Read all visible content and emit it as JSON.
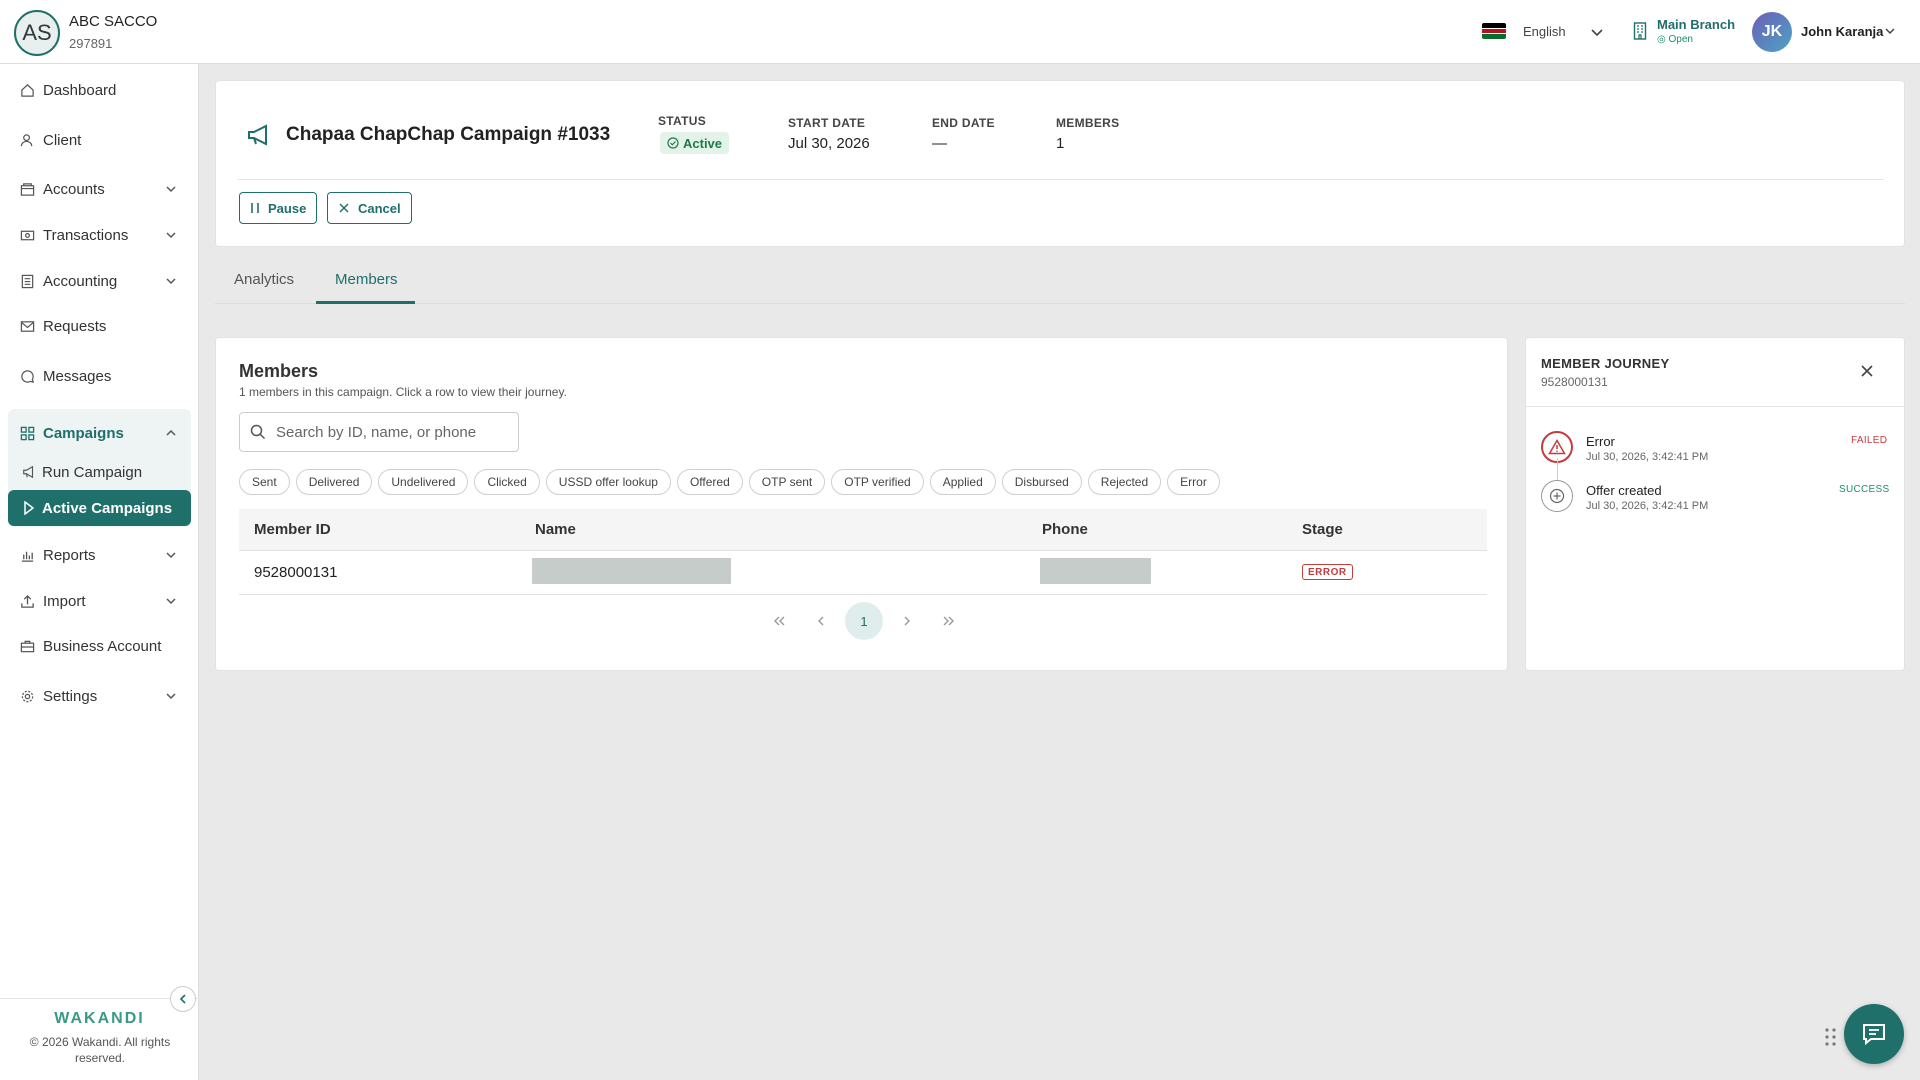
{
  "org": {
    "initials": "AS",
    "name": "ABC SACCO",
    "id": "297891"
  },
  "topbar": {
    "language": "English",
    "branch_name": "Main Branch",
    "branch_status": "Open",
    "user_initials": "JK",
    "user_name": "John Karanja"
  },
  "sidebar": {
    "items": [
      {
        "label": "Dashboard",
        "icon": "home-icon"
      },
      {
        "label": "Client",
        "icon": "user-icon"
      },
      {
        "label": "Accounts",
        "icon": "wallet-icon"
      },
      {
        "label": "Transactions",
        "icon": "money-icon"
      },
      {
        "label": "Accounting",
        "icon": "ledger-icon"
      },
      {
        "label": "Requests",
        "icon": "mail-icon"
      },
      {
        "label": "Messages",
        "icon": "chat-icon"
      },
      {
        "label": "Campaigns",
        "icon": "grid-icon"
      },
      {
        "label": "Reports",
        "icon": "bar-chart-icon"
      },
      {
        "label": "Import",
        "icon": "upload-icon"
      },
      {
        "label": "Business Account",
        "icon": "briefcase-icon"
      },
      {
        "label": "Settings",
        "icon": "gear-icon"
      }
    ],
    "sub_items": [
      {
        "label": "Run Campaign",
        "icon": "megaphone-icon"
      },
      {
        "label": "Active Campaigns",
        "icon": "play-icon"
      }
    ],
    "brand": "WAKANDI",
    "copyright": "© 2026 Wakandi. All rights reserved."
  },
  "campaign": {
    "title": "Chapaa ChapChap Campaign #1033",
    "status_label": "STATUS",
    "status_value": "Active",
    "start_label": "START DATE",
    "start_value": "Jul 30, 2026",
    "end_label": "END DATE",
    "end_value": "—",
    "members_label": "MEMBERS",
    "members_value": "1",
    "pause_label": "Pause",
    "cancel_label": "Cancel"
  },
  "tabs": [
    {
      "label": "Analytics",
      "active": false
    },
    {
      "label": "Members",
      "active": true
    }
  ],
  "members": {
    "title": "Members",
    "subtitle": "1 members in this campaign. Click a row to view their journey.",
    "search_placeholder": "Search by ID, name, or phone",
    "filters": [
      "Sent",
      "Delivered",
      "Undelivered",
      "Clicked",
      "USSD offer lookup",
      "Offered",
      "OTP sent",
      "OTP verified",
      "Applied",
      "Disbursed",
      "Rejected",
      "Error"
    ],
    "columns": [
      "Member ID",
      "Name",
      "Phone",
      "Stage"
    ],
    "rows": [
      {
        "member_id": "9528000131",
        "stage": "ERROR"
      }
    ],
    "current_page": "1"
  },
  "journey": {
    "title": "MEMBER JOURNEY",
    "member_id": "9528000131",
    "events": [
      {
        "label": "Error",
        "time": "Jul 30, 2026, 3:42:41 PM",
        "status": "FAILED",
        "status_color": "#c43c3c",
        "icon": "warning-icon"
      },
      {
        "label": "Offer created",
        "time": "Jul 30, 2026, 3:42:41 PM",
        "status": "SUCCESS",
        "status_color": "#1f8f6a",
        "icon": "plus-circle-icon"
      }
    ]
  },
  "colors": {
    "accent": "#1f6f6a",
    "error": "#c43c3c",
    "success": "#1f8f6a"
  }
}
